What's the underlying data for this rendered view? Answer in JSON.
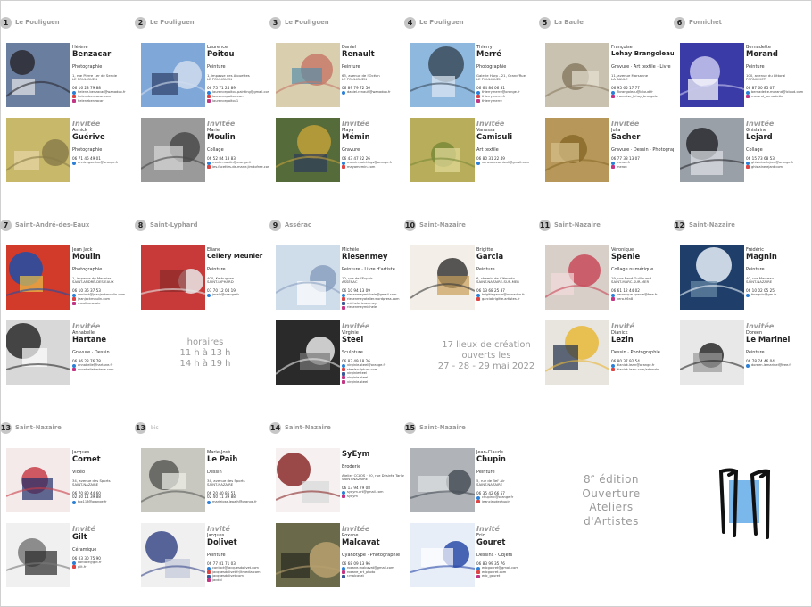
{
  "columns": [
    {
      "num": "1",
      "town": "Le Pouliguen",
      "main": {
        "first": "Hélène",
        "last": "Benzacar",
        "discipline": "Photographie",
        "address": [
          "1, rue Pierre 1er de Serbie",
          "LE POULIGUEN"
        ],
        "phone": "06 16 28 79 88",
        "contacts": [
          {
            "k": "m",
            "t": "helene.benzacar@wanadoo.fr"
          },
          {
            "k": "w",
            "t": "helenebenzacar.com"
          },
          {
            "k": "i",
            "t": "helenebenzacar"
          }
        ]
      },
      "guest": {
        "label": "Invitée",
        "first": "Annick",
        "last": "Guérive",
        "discipline": "Photographie",
        "phone": "06 71 46 49 01",
        "contacts": [
          {
            "k": "m",
            "t": "annickguerive@orange.fr"
          }
        ]
      }
    },
    {
      "num": "2",
      "town": "Le Pouliguen",
      "main": {
        "first": "Laurence",
        "last": "Poitou",
        "discipline": "Peinture",
        "address": [
          "1, impasse des Alouettes",
          "LE POULIGUEN"
        ],
        "phone": "06 75 71 24 89",
        "contacts": [
          {
            "k": "m",
            "t": "laurencepoitou.painting@gmail.com"
          },
          {
            "k": "w",
            "t": "laurencepoitou.com"
          },
          {
            "k": "i",
            "t": "laurencepoitou1"
          }
        ]
      },
      "guest": {
        "label": "Invitée",
        "first": "Marie",
        "last": "Moulin",
        "discipline": "Collage",
        "phone": "06 52 84 18 83",
        "contacts": [
          {
            "k": "m",
            "t": "marie.moulin@orange.fr"
          },
          {
            "k": "w",
            "t": "les-facettes-de-marie.jimdofree.com"
          }
        ]
      }
    },
    {
      "num": "3",
      "town": "Le Pouliguen",
      "main": {
        "first": "Daniel",
        "last": "Renault",
        "discipline": "Peinture",
        "address": [
          "63, avenue de l'Océan",
          "LE POULIGUEN"
        ],
        "phone": "06 89 79 72 56",
        "contacts": [
          {
            "k": "m",
            "t": "daniel.renault@wanadoo.fr"
          }
        ]
      },
      "guest": {
        "label": "Invitée",
        "first": "Maya",
        "last": "Mémin",
        "discipline": "Gravure",
        "phone": "06 43 47 22 26",
        "contacts": [
          {
            "k": "m",
            "t": "memin.paintings@orange.fr"
          },
          {
            "k": "w",
            "t": "mayamemin.com"
          }
        ]
      }
    },
    {
      "num": "4",
      "town": "Le Pouliguen",
      "main": {
        "first": "Thierry",
        "last": "Merré",
        "discipline": "Photographie",
        "address": [
          "Galerie Harp - 21, Grand'Rue",
          "LE POULIGUEN"
        ],
        "phone": "06 64 84 06 81",
        "contacts": [
          {
            "k": "m",
            "t": "thierrymerre@orange.fr"
          },
          {
            "k": "w",
            "t": "thierrymerre.fr"
          },
          {
            "k": "i",
            "t": "thierrymerre"
          }
        ]
      },
      "guest": {
        "label": "Invitée",
        "first": "Vanessa",
        "last": "Camisuli",
        "discipline": "Art textile",
        "phone": "06 80 31 22 49",
        "contacts": [
          {
            "k": "m",
            "t": "vanessa.camisuli@gmail.com"
          }
        ]
      }
    },
    {
      "num": "5",
      "town": "La Baule",
      "main": {
        "first": "Françoise",
        "last": "Lehay Brangoleau",
        "discipline": "Gravure · Art textile · Livre",
        "address": [
          "11, avenue Marsanne",
          "LA BAULE"
        ],
        "phone": "06 95 65 17 77",
        "contacts": [
          {
            "k": "m",
            "t": "flbrangoleau@icloud.fr"
          },
          {
            "k": "i",
            "t": "francoise_lehay_brangole"
          }
        ]
      },
      "guest": {
        "label": "Invitée",
        "first": "Julia",
        "last": "Sacher",
        "discipline": "Gravure · Dessin · Photographie",
        "phone": "06 77 38 13 07",
        "contacts": [
          {
            "k": "m",
            "t": "merou.fr"
          },
          {
            "k": "i",
            "t": "merou"
          }
        ]
      }
    },
    {
      "num": "6",
      "town": "Pornichet",
      "main": {
        "first": "Bernadette",
        "last": "Morand",
        "discipline": "Peinture",
        "address": [
          "100, avenue du Littoral",
          "PORNICHET"
        ],
        "phone": "06 87 60 85 07",
        "contacts": [
          {
            "k": "m",
            "t": "bernadette.morand@icloud.com"
          },
          {
            "k": "i",
            "t": "morand_bernadette"
          }
        ]
      },
      "guest": {
        "label": "Invitée",
        "first": "Ghislaine",
        "last": "Lejard",
        "discipline": "Collage",
        "phone": "06 15 73 68 53",
        "contacts": [
          {
            "k": "m",
            "t": "ghislaine.lejard@orange.fr"
          },
          {
            "k": "w",
            "t": "ghislainelejard.com"
          }
        ]
      }
    },
    {
      "num": "7",
      "town": "Saint-André-des-Eaux",
      "main": {
        "first": "Jean Jack",
        "last": "Moulin",
        "discipline": "Photographie",
        "address": [
          "1, impasse du Meunier",
          "SAINT-ANDRÉ-DES-EAUX"
        ],
        "phone": "06 10 36 37 53",
        "contacts": [
          {
            "k": "m",
            "t": "contact@jeanjackmoulin.com"
          },
          {
            "k": "w",
            "t": "jeanjackmoulin.com"
          },
          {
            "k": "i",
            "t": "moulinarasoie"
          }
        ]
      },
      "guest": {
        "label": "Invitée",
        "first": "Annabelle",
        "last": "Hartane",
        "discipline": "Gravure · Dessin",
        "phone": "06 86 28 76 78",
        "contacts": [
          {
            "k": "m",
            "t": "annabelle@hartane.fr"
          },
          {
            "k": "i",
            "t": "annabellehartane.com"
          }
        ]
      }
    },
    {
      "num": "8",
      "town": "Saint-Lyphard",
      "main": {
        "first": "Eliane",
        "last": "Cellery Meunier",
        "discipline": "Peinture",
        "address": [
          "400, Kerhuguen",
          "SAINT-LYPHARD"
        ],
        "phone": "07 70 12 04 19",
        "contacts": [
          {
            "k": "m",
            "t": "jmelo@orange.fr"
          }
        ]
      }
    },
    {
      "num": "9",
      "town": "Assérac",
      "main": {
        "first": "Michèle",
        "last": "Riesenmey",
        "discipline": "Peinture · Livre d'artiste",
        "address": [
          "10, rue de l'Espoir",
          "ASSÉRAC"
        ],
        "phone": "06 10 94 13 09",
        "contacts": [
          {
            "k": "m",
            "t": "riesenmeymichele@gmail.com"
          },
          {
            "k": "w",
            "t": "riesenmeyatelier.wordpress.com"
          },
          {
            "k": "f",
            "t": "micheleriesenmey"
          },
          {
            "k": "i",
            "t": "riesenmeymichele"
          }
        ]
      },
      "guest": {
        "label": "Invitée",
        "first": "Virginie",
        "last": "Steel",
        "discipline": "Sculpture",
        "phone": "06 83 49 18 26",
        "contacts": [
          {
            "k": "m",
            "t": "virginie.steel@orange.fr"
          },
          {
            "k": "w",
            "t": "steelsculpture.com"
          },
          {
            "k": "f",
            "t": "virginiesteel"
          },
          {
            "k": "i",
            "t": "virginie.steel"
          },
          {
            "k": "i",
            "t": "virginie.steel"
          }
        ]
      }
    },
    {
      "num": "10",
      "town": "Saint-Nazaire",
      "main": {
        "first": "Brigitte",
        "last": "Garcia",
        "discipline": "Peinture",
        "address": [
          "6, chemin de Clémodo",
          "SAINT-NAZAIRE-SUR-MER"
        ],
        "phone": "06 13 68 25 87",
        "contacts": [
          {
            "k": "m",
            "t": "brigittegarcia@wanadoo.fr"
          },
          {
            "k": "w",
            "t": "garciabrigitte.artistes.fr"
          }
        ]
      }
    },
    {
      "num": "11",
      "town": "Saint-Nazaire",
      "main": {
        "first": "Véronique",
        "last": "Spenle",
        "discipline": "Collage numérique",
        "address": [
          "19, rue René Guillouard",
          "SAINT-MARC-SUR-MER"
        ],
        "phone": "06 61 12 44 02",
        "contacts": [
          {
            "k": "m",
            "t": "veronique.spenle@free.fr"
          },
          {
            "k": "i",
            "t": "vero.66n8"
          }
        ]
      },
      "guest": {
        "label": "Invité",
        "first": "Dianick",
        "last": "Lezin",
        "discipline": "Dessin · Photographie",
        "phone": "06 80 37 92 54",
        "contacts": [
          {
            "k": "m",
            "t": "dianick.lezin@orange.fr"
          },
          {
            "k": "w",
            "t": "dianick-lezin.com/artworks"
          }
        ]
      }
    },
    {
      "num": "12",
      "town": "Saint-Nazaire",
      "main": {
        "first": "Frédéric",
        "last": "Magnin",
        "discipline": "Peinture",
        "address": [
          "40, rue Marceau",
          "SAINT-NAZAIRE"
        ],
        "phone": "06 10 02 05 25",
        "contacts": [
          {
            "k": "m",
            "t": "fmagnin@gm.fr"
          }
        ]
      },
      "guest": {
        "label": "Invitée",
        "first": "Doreen",
        "last": "Le Marinel",
        "discipline": "Peinture",
        "phone": "06 78 74 46 04",
        "contacts": [
          {
            "k": "m",
            "t": "doreen.lemarinel@free.fr"
          }
        ]
      }
    },
    {
      "num": "13",
      "town": "Saint-Nazaire",
      "main": {
        "first": "Jacques",
        "last": "Cornet",
        "discipline": "Vidéo",
        "address": [
          "34, avenue des Sports",
          "SAINT-NAZAIRE"
        ],
        "phone": "06 70 80 44 60",
        "phone2": "02 40 11 39 88",
        "contacts": [
          {
            "k": "m",
            "t": "tox113@orange.fr"
          }
        ]
      },
      "guest": {
        "label": "Invité",
        "first": "",
        "last": "Gilt",
        "discipline": "Céramique",
        "phone": "06 03 30 75 90",
        "contacts": [
          {
            "k": "m",
            "t": "contact@gilt.fr"
          },
          {
            "k": "w",
            "t": "gilt.fr"
          }
        ]
      }
    },
    {
      "num": "13",
      "bis": "bis",
      "town": "",
      "main": {
        "first": "Marie-José",
        "last": "Le Paih",
        "discipline": "Dessin",
        "address": [
          "34, avenue des Sports",
          "SAINT-NAZAIRE"
        ],
        "phone": "06 20 40 85 51",
        "phone2": "02 40 11 39 88",
        "contacts": [
          {
            "k": "m",
            "t": "mariejose.lepaih@orange.fr"
          }
        ]
      },
      "guest": {
        "label": "Invité",
        "first": "Jacques",
        "last": "Dolivet",
        "discipline": "Peinture",
        "phone": "06 77 81 71 03",
        "contacts": [
          {
            "k": "m",
            "t": "contact@jacquesdolivet.com"
          },
          {
            "k": "w",
            "t": "jacquesdolivet.fr/ltmedia.com"
          },
          {
            "k": "f",
            "t": "jacquesdolivet.com"
          },
          {
            "k": "i",
            "t": "jacdol"
          }
        ]
      }
    },
    {
      "num": "14",
      "town": "Saint-Nazaire",
      "main": {
        "first": "",
        "last": "SyEym",
        "discipline": "Broderie",
        "address": [
          "Atelier CCLOS · 20, rue Désirée Tarlosé",
          "SAINT-NAZAIRE"
        ],
        "phone": "06 13 94 79 08",
        "contacts": [
          {
            "k": "m",
            "t": "syeym.art@gmail.com"
          },
          {
            "k": "i",
            "t": "syeym"
          }
        ]
      },
      "guest": {
        "label": "Invitée",
        "first": "Roxane",
        "last": "Malcavat",
        "discipline": "Cyanotype · Photographie",
        "phone": "06 68 09 13 96",
        "contacts": [
          {
            "k": "m",
            "t": "roxane.malcavat@gmail.com"
          },
          {
            "k": "i",
            "t": "roxane_art_photo"
          },
          {
            "k": "f",
            "t": "r.malcavat"
          }
        ]
      }
    },
    {
      "num": "15",
      "town": "Saint-Nazaire",
      "main": {
        "first": "Jean-Claude",
        "last": "Chupin",
        "discipline": "Peinture",
        "address": [
          "5, rue de Bel' Air",
          "SAINT-NAZAIRE"
        ],
        "phone": "06 35 42 66 57",
        "contacts": [
          {
            "k": "m",
            "t": "chupinjc@orange.fr"
          },
          {
            "k": "w",
            "t": "jeanclaudechupin"
          }
        ]
      },
      "guest": {
        "label": "Invité",
        "first": "Eric",
        "last": "Gouret",
        "discipline": "Dessins · Objets",
        "phone": "06 83 99 35 76",
        "contacts": [
          {
            "k": "m",
            "t": "ericgouret@gmail.com"
          },
          {
            "k": "w",
            "t": "ericgouret.com"
          },
          {
            "k": "i",
            "t": "eric_gouret"
          }
        ]
      }
    }
  ],
  "hours": {
    "title": "horaires",
    "l1": "11 h à 13 h",
    "l2": "14 h à 19 h"
  },
  "event": {
    "l1": "17 lieux de création",
    "l2": "ouverts les",
    "l3": "27 - 28 - 29 mai 2022"
  },
  "edition": {
    "num": "8",
    "sup": "e",
    "word": " édition",
    "l1": "Ouverture",
    "l2": "Ateliers",
    "l3": "d'Artistes"
  },
  "colors": {
    "accent": "#9a9a9a",
    "badge": "#c6c6c6",
    "logo_blue": "#7ab7ea"
  }
}
